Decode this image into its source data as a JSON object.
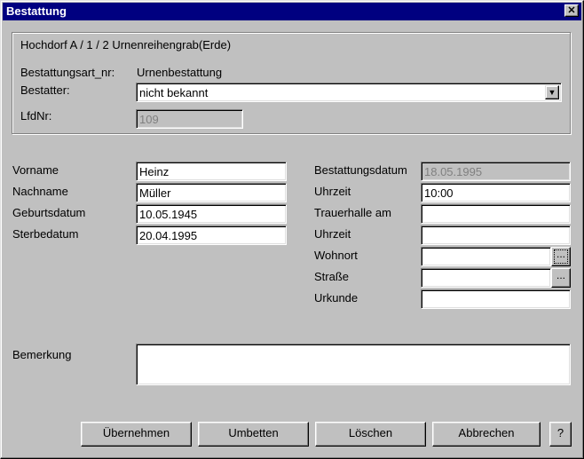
{
  "window": {
    "title": "Bestattung",
    "close_glyph": "✕"
  },
  "group": {
    "header": "Hochdorf  A / 1 / 2   Urnenreihengrab(Erde)",
    "bestattungsart_label": "Bestattungsart_nr:",
    "bestattungsart_value": "Urnenbestattung",
    "bestatter_label": "Bestatter:",
    "bestatter_value": "nicht bekannt",
    "lfdnr_label": "LfdNr:",
    "lfdnr_value": "109"
  },
  "person": {
    "vorname_label": "Vorname",
    "vorname_value": "Heinz",
    "nachname_label": "Nachname",
    "nachname_value": "Müller",
    "geburtsdatum_label": "Geburtsdatum",
    "geburtsdatum_value": "10.05.1945",
    "sterbedatum_label": "Sterbedatum",
    "sterbedatum_value": "20.04.1995"
  },
  "burial": {
    "bestattungsdatum_label": "Bestattungsdatum",
    "bestattungsdatum_value": "18.05.1995",
    "uhrzeit_label": "Uhrzeit",
    "uhrzeit_value": "10:00",
    "trauerhalle_label": "Trauerhalle am",
    "trauerhalle_value": "",
    "uhrzeit2_label": "Uhrzeit",
    "uhrzeit2_value": "",
    "wohnort_label": "Wohnort",
    "wohnort_value": "",
    "strasse_label": "Straße",
    "strasse_value": "",
    "urkunde_label": "Urkunde",
    "urkunde_value": "",
    "picker_glyph": "..."
  },
  "bemerkung": {
    "label": "Bemerkung",
    "value": ""
  },
  "buttons": {
    "uebernehmen": "Übernehmen",
    "umbetten": "Umbetten",
    "loeschen": "Löschen",
    "abbrechen": "Abbrechen",
    "help": "?"
  }
}
